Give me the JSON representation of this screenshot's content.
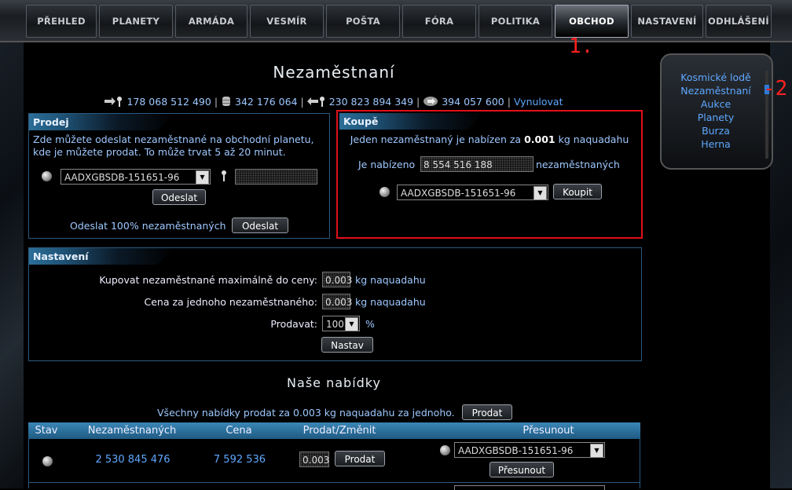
{
  "nav": {
    "tabs": [
      {
        "label": "PŘEHLED",
        "active": false
      },
      {
        "label": "PLANETY",
        "active": false
      },
      {
        "label": "ARMÁDA",
        "active": false
      },
      {
        "label": "VESMÍR",
        "active": false
      },
      {
        "label": "POŠTA",
        "active": false
      },
      {
        "label": "FÓRA",
        "active": false
      },
      {
        "label": "POLITIKA",
        "active": false
      },
      {
        "label": "OBCHOD",
        "active": true
      },
      {
        "label": "NASTAVENÍ",
        "active": false
      },
      {
        "label": "ODHLÁŠENÍ",
        "active": false
      }
    ]
  },
  "annotations": {
    "one": "1.",
    "two": "-2."
  },
  "page": {
    "title": "Nezaměstnaní"
  },
  "resources": {
    "r1": "178 068 512 490",
    "r2": "342 176 064",
    "r3": "230 823 894 349",
    "r4": "394 057 600",
    "sep": "|",
    "reset": "Vynulovat"
  },
  "sidebar": {
    "items": [
      "Kosmické lodě",
      "Nezaměstnaní",
      "Aukce",
      "Planety",
      "Burza",
      "Herna"
    ]
  },
  "sell": {
    "heading": "Prodej",
    "desc": "Zde můžete odeslat nezaměstnané na obchodní planetu, kde je můžete prodat. To může trvat 5 až 20 minut.",
    "planet": "AADXGBSDB-151651-96",
    "amount": "",
    "send": "Odeslat",
    "send_all_label": "Odeslat 100% nezaměstnaných",
    "send_all": "Odeslat"
  },
  "buy": {
    "heading": "Koupě",
    "offer_pre": "Jeden nezaměstnaný je nabízen za",
    "offer_price": "0.001",
    "offer_post": "kg naquadahu",
    "offered_pre": "Je nabízeno",
    "offered_value": "8 554 516 188",
    "offered_post": "nezaměstnaných",
    "planet": "AADXGBSDB-151651-96",
    "buy": "Koupit"
  },
  "settings": {
    "heading": "Nastavení",
    "max_label": "Kupovat nezaměstnané maximálně do ceny:",
    "max_value": "0.003",
    "price_label": "Cena za jednoho nezaměstnaného:",
    "price_value": "0.003",
    "unit": "kg naquadahu",
    "sell_label": "Prodavat:",
    "sell_value": "100",
    "percent": "%",
    "save": "Nastav"
  },
  "offers": {
    "heading": "Naše nabídky",
    "all_label": "Všechny nabídky prodat za 0.003 kg naquadahu za jednoho.",
    "all_btn": "Prodat",
    "columns": [
      "Stav",
      "Nezaměstnaných",
      "Cena",
      "Prodat/Změnit",
      "Přesunout"
    ],
    "row": {
      "count": "2 530 845 476",
      "price": "7 592 536",
      "change_value": "0.003",
      "sell": "Prodat",
      "planet": "AADXGBSDB-151651-96",
      "move": "Přesunout"
    }
  }
}
